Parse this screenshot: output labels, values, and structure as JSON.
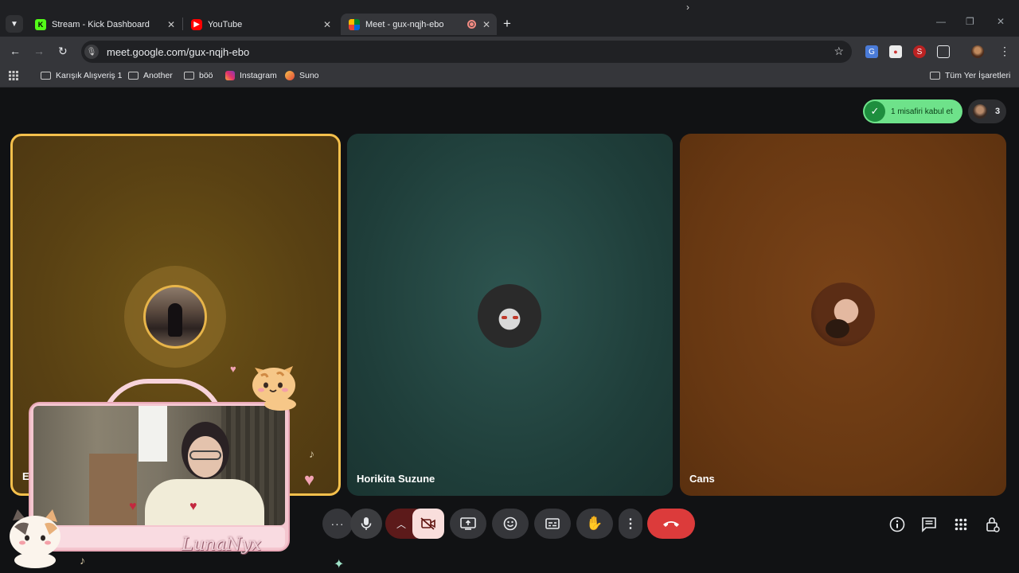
{
  "browser": {
    "tabs": [
      {
        "title": "Stream - Kick Dashboard",
        "favicon": "kick-icon",
        "active": false
      },
      {
        "title": "YouTube",
        "favicon": "youtube-icon",
        "active": false
      },
      {
        "title": "Meet - gux-nqjh-ebo",
        "favicon": "meet-icon",
        "active": true,
        "recording": true
      }
    ],
    "url": "meet.google.com/gux-nqjh-ebo",
    "bookmarks": [
      {
        "label": "Karışık Alışveriş 1",
        "icon": "folder-icon"
      },
      {
        "label": "Another",
        "icon": "folder-icon"
      },
      {
        "label": "böö",
        "icon": "folder-icon"
      },
      {
        "label": "Instagram",
        "icon": "instagram-icon"
      },
      {
        "label": "Suno",
        "icon": "suno-icon"
      }
    ],
    "all_bookmarks": "Tüm Yer İşaretleri"
  },
  "meet": {
    "admit": {
      "label": "1 misafiri kabul et"
    },
    "participants_count": "3",
    "tiles": [
      {
        "name": "E",
        "speaking": true
      },
      {
        "name": "Horikita Suzune",
        "speaking": false
      },
      {
        "name": "Cans",
        "speaking": false
      }
    ],
    "controls": {
      "more": "more-options-icon",
      "mic": "mic-icon",
      "camera_off": "camera-off-icon",
      "present": "present-screen-icon",
      "reactions": "emoji-icon",
      "captions": "captions-icon",
      "raise_hand": "raise-hand-icon",
      "more_vert": "more-vert-icon",
      "leave": "end-call-icon"
    },
    "right_controls": [
      "info-icon",
      "chat-icon",
      "activities-icon",
      "host-controls-icon"
    ]
  },
  "overlay": {
    "streamer_name": "LunaNyx"
  },
  "colors": {
    "speaking_border": "#f5c04c",
    "admit_pill": "#6ee28a",
    "end_call": "#dc3b3b"
  }
}
